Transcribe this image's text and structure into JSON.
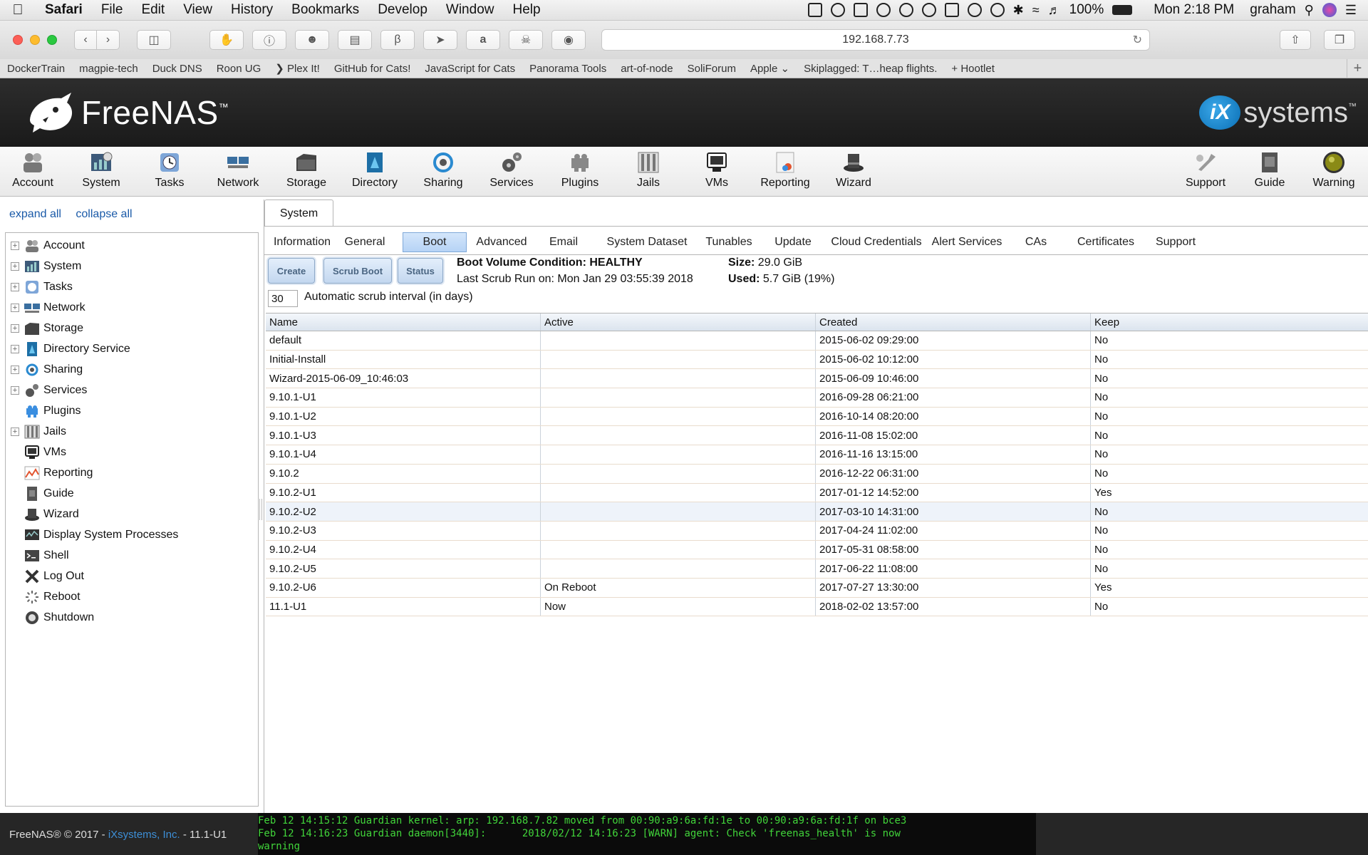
{
  "mac_menu": {
    "app": "Safari",
    "items": [
      "File",
      "Edit",
      "View",
      "History",
      "Bookmarks",
      "Develop",
      "Window",
      "Help"
    ],
    "battery": "100%",
    "clock": "Mon 2:18 PM",
    "user": "graham"
  },
  "safari": {
    "url": "192.168.7.73",
    "bookmarks": [
      "DockerTrain",
      "magpie-tech",
      "Duck DNS",
      "Roon UG",
      "❯ Plex It!",
      "GitHub for Cats!",
      "JavaScript for Cats",
      "Panorama Tools",
      "art-of-node",
      "SoliForum",
      "Apple ⌄",
      "Skiplagged: T…heap flights.",
      "+ Hootlet"
    ]
  },
  "header": {
    "logo_text": "FreeNAS",
    "logo_tm": "™",
    "vendor_ix": "iX",
    "vendor_text": "systems",
    "vendor_tm": "™"
  },
  "topnav": [
    {
      "label": "Account",
      "icon": "account-icon"
    },
    {
      "label": "System",
      "icon": "system-icon"
    },
    {
      "label": "Tasks",
      "icon": "tasks-icon"
    },
    {
      "label": "Network",
      "icon": "network-icon"
    },
    {
      "label": "Storage",
      "icon": "storage-icon"
    },
    {
      "label": "Directory",
      "icon": "directory-icon"
    },
    {
      "label": "Sharing",
      "icon": "sharing-icon"
    },
    {
      "label": "Services",
      "icon": "services-icon"
    },
    {
      "label": "Plugins",
      "icon": "plugins-icon"
    },
    {
      "label": "Jails",
      "icon": "jails-icon"
    },
    {
      "label": "VMs",
      "icon": "vms-icon"
    },
    {
      "label": "Reporting",
      "icon": "reporting-icon"
    },
    {
      "label": "Wizard",
      "icon": "wizard-icon"
    },
    {
      "label": "Support",
      "icon": "support-icon"
    },
    {
      "label": "Guide",
      "icon": "guide-icon"
    },
    {
      "label": "Warning",
      "icon": "warning-icon"
    }
  ],
  "tree": {
    "expand_all": "expand all",
    "collapse_all": "collapse all",
    "items": [
      {
        "label": "Account",
        "expandable": true
      },
      {
        "label": "System",
        "expandable": true
      },
      {
        "label": "Tasks",
        "expandable": true
      },
      {
        "label": "Network",
        "expandable": true
      },
      {
        "label": "Storage",
        "expandable": true
      },
      {
        "label": "Directory Service",
        "expandable": true
      },
      {
        "label": "Sharing",
        "expandable": true
      },
      {
        "label": "Services",
        "expandable": true
      },
      {
        "label": "Plugins",
        "expandable": false
      },
      {
        "label": "Jails",
        "expandable": true
      },
      {
        "label": "VMs",
        "expandable": false
      },
      {
        "label": "Reporting",
        "expandable": false
      },
      {
        "label": "Guide",
        "expandable": false
      },
      {
        "label": "Wizard",
        "expandable": false
      },
      {
        "label": "Display System Processes",
        "expandable": false
      },
      {
        "label": "Shell",
        "expandable": false
      },
      {
        "label": "Log Out",
        "expandable": false
      },
      {
        "label": "Reboot",
        "expandable": false
      },
      {
        "label": "Shutdown",
        "expandable": false
      }
    ]
  },
  "main": {
    "outer_tab": "System",
    "subtabs": [
      "Information",
      "General",
      "Boot",
      "Advanced",
      "Email",
      "System Dataset",
      "Tunables",
      "Update",
      "Cloud Credentials",
      "Alert Services",
      "CAs",
      "Certificates",
      "Support"
    ],
    "active_subtab": "Boot",
    "buttons": {
      "create": "Create",
      "scrub_boot": "Scrub Boot",
      "status": "Status"
    },
    "condition_label": "Boot Volume Condition: HEALTHY",
    "last_scrub": "Last Scrub Run on: Mon Jan 29 03:55:39 2018",
    "size_label": "Size:",
    "size_value": "29.0 GiB",
    "used_label": "Used:",
    "used_value": "5.7 GiB (19%)",
    "interval_value": "30",
    "interval_label": "Automatic scrub interval (in days)",
    "columns": [
      "Name",
      "Active",
      "Created",
      "Keep"
    ],
    "rows": [
      {
        "name": "default",
        "active": "",
        "created": "2015-06-02 09:29:00",
        "keep": "No"
      },
      {
        "name": "Initial-Install",
        "active": "",
        "created": "2015-06-02 10:12:00",
        "keep": "No"
      },
      {
        "name": "Wizard-2015-06-09_10:46:03",
        "active": "",
        "created": "2015-06-09 10:46:00",
        "keep": "No"
      },
      {
        "name": "9.10.1-U1",
        "active": "",
        "created": "2016-09-28 06:21:00",
        "keep": "No"
      },
      {
        "name": "9.10.1-U2",
        "active": "",
        "created": "2016-10-14 08:20:00",
        "keep": "No"
      },
      {
        "name": "9.10.1-U3",
        "active": "",
        "created": "2016-11-08 15:02:00",
        "keep": "No"
      },
      {
        "name": "9.10.1-U4",
        "active": "",
        "created": "2016-11-16 13:15:00",
        "keep": "No"
      },
      {
        "name": "9.10.2",
        "active": "",
        "created": "2016-12-22 06:31:00",
        "keep": "No"
      },
      {
        "name": "9.10.2-U1",
        "active": "",
        "created": "2017-01-12 14:52:00",
        "keep": "Yes"
      },
      {
        "name": "9.10.2-U2",
        "active": "",
        "created": "2017-03-10 14:31:00",
        "keep": "No"
      },
      {
        "name": "9.10.2-U3",
        "active": "",
        "created": "2017-04-24 11:02:00",
        "keep": "No"
      },
      {
        "name": "9.10.2-U4",
        "active": "",
        "created": "2017-05-31 08:58:00",
        "keep": "No"
      },
      {
        "name": "9.10.2-U5",
        "active": "",
        "created": "2017-06-22 11:08:00",
        "keep": "No"
      },
      {
        "name": "9.10.2-U6",
        "active": "On Reboot",
        "created": "2017-07-27 13:30:00",
        "keep": "Yes"
      },
      {
        "name": "11.1-U1",
        "active": "Now",
        "created": "2018-02-02 13:57:00",
        "keep": "No"
      }
    ]
  },
  "footer": {
    "copyright": "FreeNAS® © 2017 - ",
    "company": "iXsystems, Inc.",
    "version": " - 11.1-U1",
    "console": [
      "Feb 12 14:15:12 Guardian kernel: arp: 192.168.7.82 moved from 00:90:a9:6a:fd:1e to 00:90:a9:6a:fd:1f on bce3",
      "Feb 12 14:16:23 Guardian daemon[3440]:      2018/02/12 14:16:23 [WARN] agent: Check 'freenas_health' is now",
      "warning"
    ]
  },
  "colors": {
    "header_bg": "#1f1f1f",
    "link_blue": "#1a5aa8",
    "console_green": "#41d43a",
    "active_tab": "#b6d3f5"
  }
}
